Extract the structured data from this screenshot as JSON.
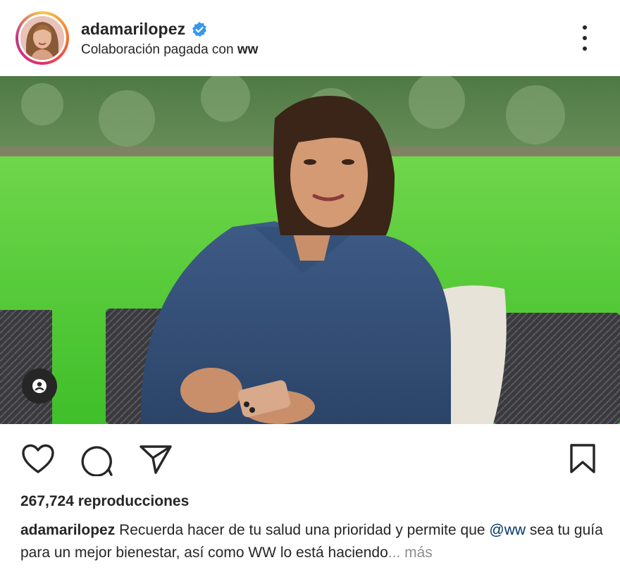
{
  "post": {
    "username": "adamarilopez",
    "subtitle_prefix": "Colaboración pagada con",
    "subtitle_partner": "ww",
    "verified_icon": "verified-badge-icon",
    "more_icon": "more-options-icon"
  },
  "actions": {
    "like_icon": "heart-icon",
    "comment_icon": "comment-icon",
    "share_icon": "send-icon",
    "save_icon": "bookmark-icon"
  },
  "stats": {
    "views": "267,724 reproducciones"
  },
  "caption": {
    "username": "adamarilopez",
    "text_part1": "Recuerda hacer de tu salud una prioridad y permite que",
    "mention": "@ww",
    "text_part2": "sea tu guía para un mejor bienestar, así como WW lo está haciendo",
    "ellipsis": "... más"
  },
  "colors": {
    "text": "#262626",
    "verified_blue": "#3897f0",
    "mention": "#00376b",
    "muted": "#8e8e8e"
  }
}
